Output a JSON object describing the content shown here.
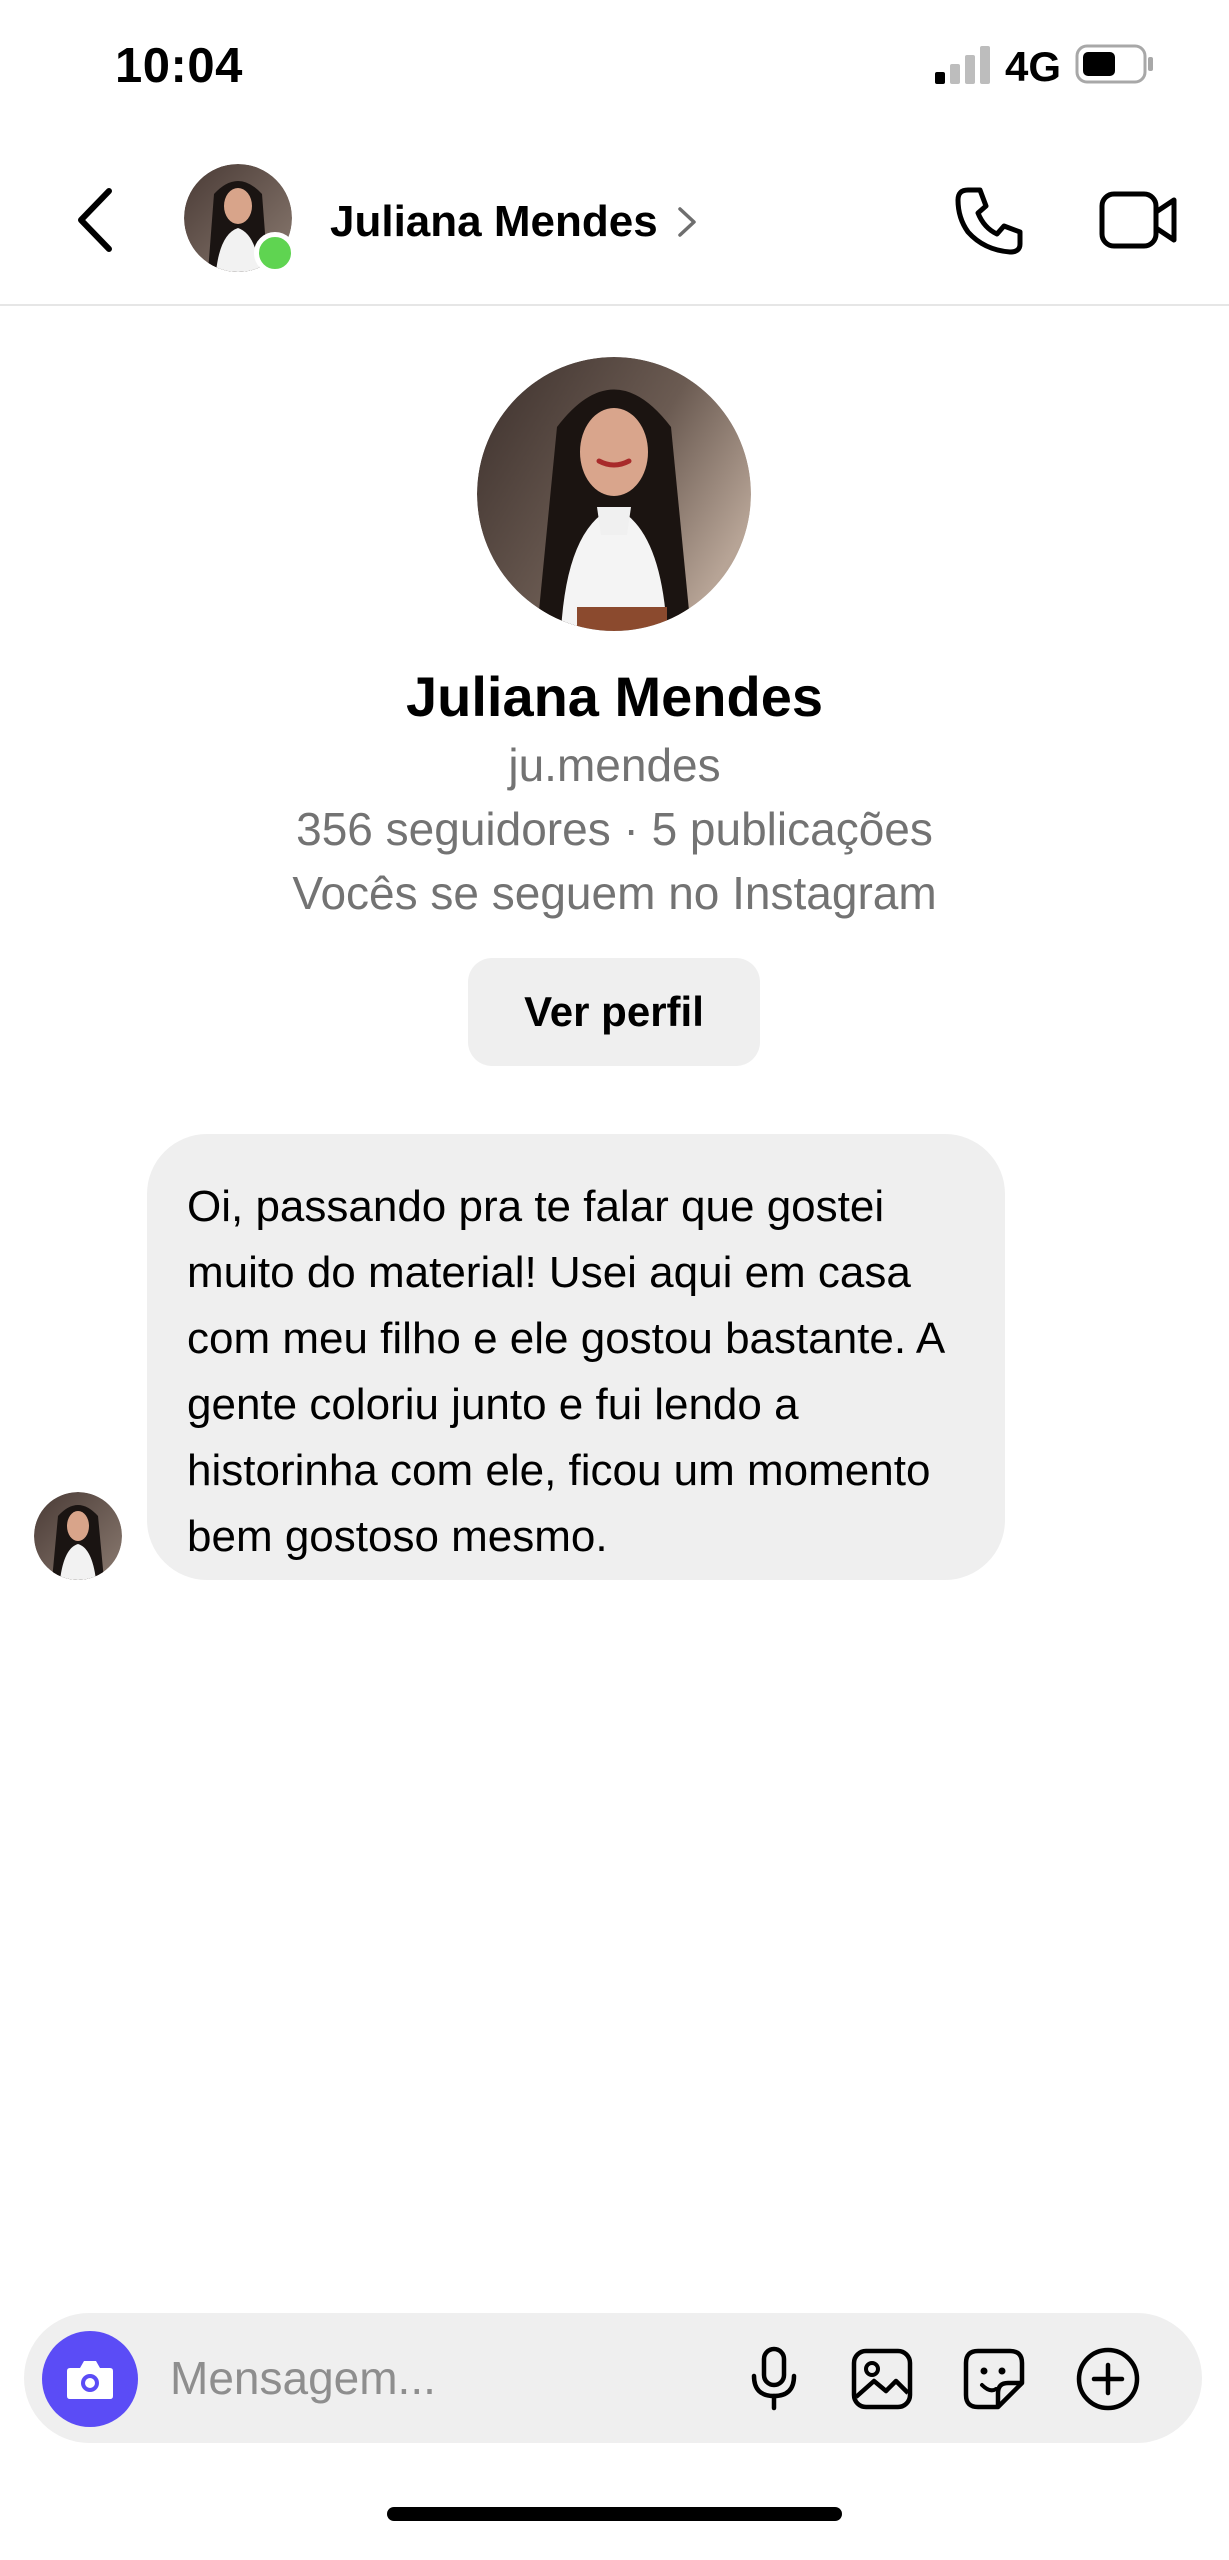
{
  "status_bar": {
    "time": "10:04",
    "network": "4G",
    "icons": [
      "signal-icon",
      "battery-icon"
    ]
  },
  "header": {
    "contact_name": "Juliana Mendes",
    "online": true,
    "icons": [
      "back-icon",
      "chevron-right-icon",
      "phone-icon",
      "video-camera-icon"
    ]
  },
  "profile": {
    "name": "Juliana Mendes",
    "username": "ju.mendes",
    "stats": "356 seguidores · 5 publicações",
    "follow_note": "Vocês se seguem no Instagram",
    "view_profile_label": "Ver perfil"
  },
  "messages": [
    {
      "sender": "Juliana Mendes",
      "text": "Oi, passando pra te falar que gostei muito do material! Usei aqui em casa com meu filho e ele gostou bastante. A gente coloriu junto e fui lendo a historinha com ele, ficou um momento bem gostoso mesmo."
    }
  ],
  "composer": {
    "placeholder": "Mensagem...",
    "value": "",
    "icons": [
      "camera-icon",
      "microphone-icon",
      "image-icon",
      "sticker-icon",
      "plus-circle-icon"
    ]
  },
  "colors": {
    "online": "#5fd451",
    "camera_button": "#5b4cf6",
    "bubble": "#efefef",
    "secondary_text": "#737373"
  }
}
